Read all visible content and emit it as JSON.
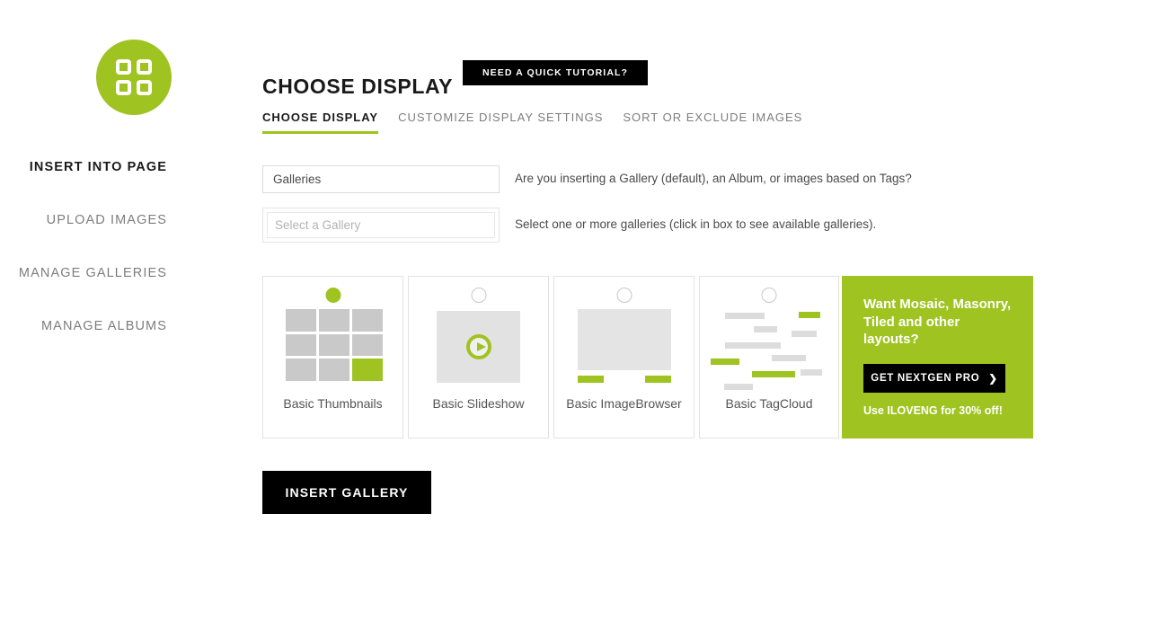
{
  "brand": {
    "logo_icon": "four-squares-grid-icon",
    "accent_color": "#9fc320",
    "dark_color": "#000000"
  },
  "header": {
    "title": "CHOOSE DISPLAY",
    "tutorial_button": "NEED A QUICK TUTORIAL?"
  },
  "tabs": [
    {
      "label": "CHOOSE DISPLAY",
      "active": true
    },
    {
      "label": "CUSTOMIZE DISPLAY SETTINGS",
      "active": false
    },
    {
      "label": "SORT OR EXCLUDE IMAGES",
      "active": false
    }
  ],
  "sidebar": {
    "items": [
      {
        "label": "INSERT INTO PAGE",
        "active": true
      },
      {
        "label": "UPLOAD IMAGES",
        "active": false
      },
      {
        "label": "MANAGE GALLERIES",
        "active": false
      },
      {
        "label": "MANAGE ALBUMS",
        "active": false
      }
    ]
  },
  "form": {
    "source_select": {
      "value": "Galleries",
      "hint": "Are you inserting a Gallery (default), an Album, or images based on Tags?"
    },
    "gallery_select": {
      "placeholder": "Select a Gallery",
      "hint": "Select one or more galleries (click in box to see available galleries)."
    }
  },
  "displays": [
    {
      "label": "Basic Thumbnails",
      "selected": true,
      "preview": "thumbnail-grid-preview"
    },
    {
      "label": "Basic Slideshow",
      "selected": false,
      "preview": "slideshow-preview"
    },
    {
      "label": "Basic ImageBrowser",
      "selected": false,
      "preview": "imagebrowser-preview"
    },
    {
      "label": "Basic TagCloud",
      "selected": false,
      "preview": "tagcloud-preview"
    }
  ],
  "promo": {
    "headline": "Want Mosaic, Masonry, Tiled and other layouts?",
    "button_label": "GET NEXTGEN PRO",
    "button_icon": "chevron-right-icon",
    "note": "Use ILOVENG for 30% off!"
  },
  "actions": {
    "insert_gallery": "INSERT GALLERY"
  }
}
